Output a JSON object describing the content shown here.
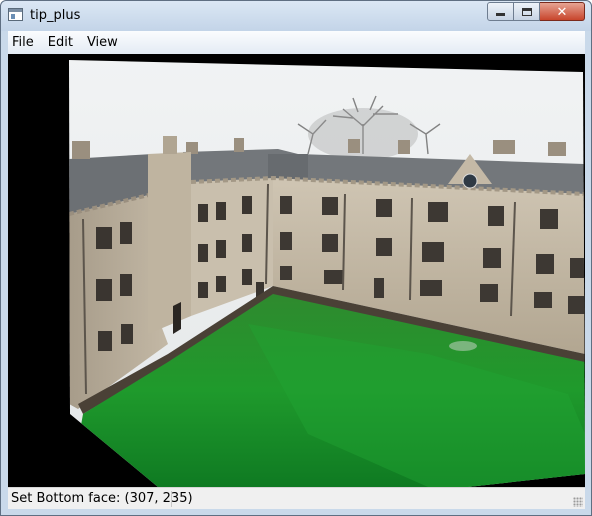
{
  "window": {
    "title": "tip_plus",
    "controls": {
      "minimize_icon": "minimize-icon",
      "maximize_icon": "maximize-icon",
      "close_label": "✕"
    }
  },
  "menu": {
    "items": [
      {
        "label": "File"
      },
      {
        "label": "Edit"
      },
      {
        "label": "View"
      }
    ]
  },
  "status": {
    "text": "Set Bottom face: (307, 235)"
  },
  "colors": {
    "titlebar": "#c9d9ea",
    "close_button": "#c8452c",
    "canvas_bg": "#000000",
    "lawn": "#1f8a2a",
    "stone": "#b7ab98",
    "roof": "#6e7276",
    "sky": "#eceff0"
  }
}
